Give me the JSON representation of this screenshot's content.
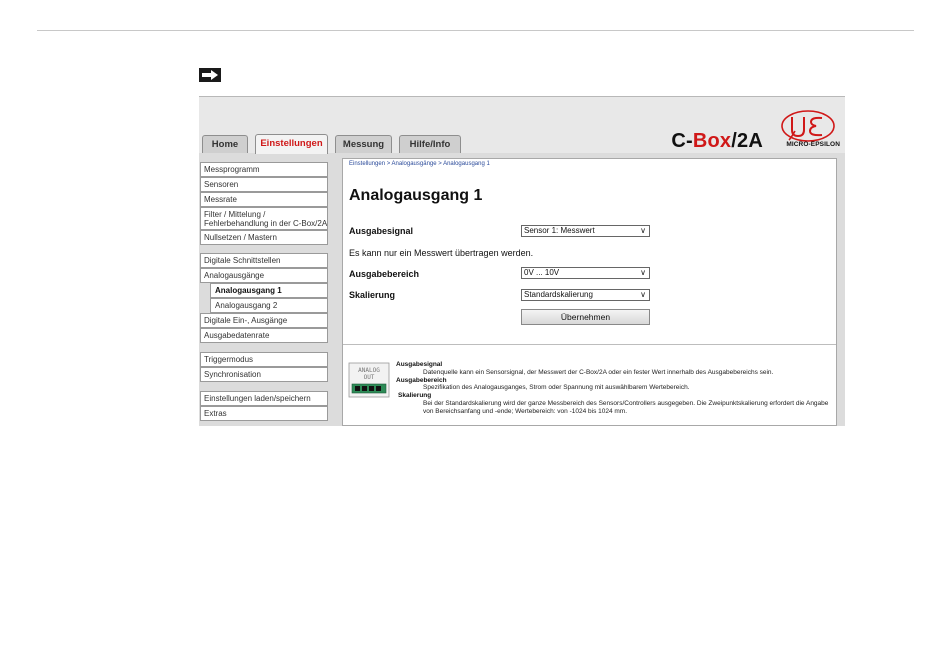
{
  "window": {
    "tabs": [
      {
        "label": "Home"
      },
      {
        "label": "Einstellungen"
      },
      {
        "label": "Messung"
      },
      {
        "label": "Hilfe/Info"
      }
    ],
    "product": {
      "prefix": "C-",
      "accent": "Box",
      "suffix": "/2A"
    },
    "logo_text": "MICRO-EPSILON"
  },
  "sidebar": {
    "items": [
      {
        "label": "Messprogramm"
      },
      {
        "label": "Sensoren"
      },
      {
        "label": "Messrate"
      },
      {
        "label_line1": "Filter / Mittelung /",
        "label_line2": "Fehlerbehandlung in der C-Box/2A"
      },
      {
        "label": "Nullsetzen / Mastern"
      },
      {
        "label": "Digitale Schnittstellen"
      },
      {
        "label": "Analogausgänge"
      },
      {
        "label": "Analogausgang 1"
      },
      {
        "label": "Analogausgang 2"
      },
      {
        "label": "Digitale Ein-, Ausgänge"
      },
      {
        "label": "Ausgabedatenrate"
      },
      {
        "label": "Triggermodus"
      },
      {
        "label": "Synchronisation"
      },
      {
        "label": "Einstellungen laden/speichern"
      },
      {
        "label": "Extras"
      }
    ]
  },
  "main": {
    "breadcrumb": "Einstellungen > Analogausgänge > Analogausgang 1",
    "title": "Analogausgang 1",
    "fields": {
      "ausgabesignal": {
        "label": "Ausgabesignal",
        "value": "Sensor 1: Messwert"
      },
      "ausgabebereich": {
        "label": "Ausgabebereich",
        "value": "0V ... 10V"
      },
      "skalierung": {
        "label": "Skalierung",
        "value": "Standardskalierung"
      }
    },
    "note": "Es kann nur ein Messwert übertragen werden.",
    "apply_label": "Übernehmen"
  },
  "help": {
    "module_text_line1": "ANALOG",
    "module_text_line2": "OUT",
    "entries": [
      {
        "heading": "Ausgabesignal",
        "text": "Datenquelle kann ein Sensorsignal, der Messwert der C-Box/2A oder ein fester Wert innerhalb des Ausgabebereichs sein."
      },
      {
        "heading": "Ausgabebereich",
        "text": "Spezifikation des Analogausganges, Strom oder Spannung mit auswählbarem Wertebereich."
      },
      {
        "heading": "Skalierung",
        "text": "Bei der Standardskalierung wird der ganze Messbereich des Sensors/Controllers ausgegeben. Die Zweipunktskalierung erfordert die Angabe von Bereichsanfang und -ende; Wertebereich: von -1024 bis 1024 mm."
      }
    ]
  },
  "colors": {
    "accent_red": "#d01818",
    "link_blue": "#2a4a9a",
    "frame_grey": "#dcdcdc"
  }
}
